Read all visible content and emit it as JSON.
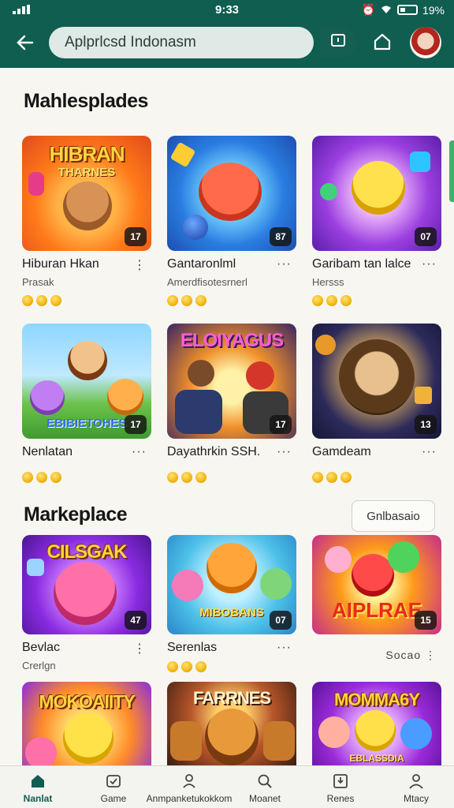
{
  "status_bar": {
    "time": "9:33",
    "battery": "19%"
  },
  "header": {
    "search_text": "Aplprlcsd Indonasm",
    "icons": [
      "back-icon",
      "chat-icon",
      "home-icon",
      "avatar"
    ]
  },
  "section1": {
    "title": "Mahlesplades",
    "cards": [
      {
        "art_title": "HIBRAN",
        "art_sub": "THARNES",
        "badge": "17",
        "name": "Hiburan Hkan",
        "sub": "Prasak",
        "more": "⋮",
        "rating": 3
      },
      {
        "art_title": "",
        "art_sub": "",
        "badge": "87",
        "name": "Gantaronlml",
        "sub": "Amerdfisotesrnerl",
        "more": "···",
        "rating": 3
      },
      {
        "art_title": "",
        "art_sub": "",
        "badge": "07",
        "name": "Garibam tan lalce",
        "sub": "Hersss",
        "more": "···",
        "rating": 3
      },
      {
        "art_title": "",
        "art_sub": "EBIBIETOHES",
        "badge": "17",
        "name": "Nenlatan",
        "sub": "",
        "more": "···",
        "rating": 3
      },
      {
        "art_title": "ELOIYAGUS",
        "art_sub": "",
        "badge": "17",
        "name": "Dayathrkin SSH.",
        "sub": "",
        "more": "···",
        "rating": 3
      },
      {
        "art_title": "",
        "art_sub": "",
        "badge": "13",
        "name": "Gamdeam",
        "sub": "",
        "more": "···",
        "rating": 3
      }
    ]
  },
  "section2": {
    "title": "Markeplace",
    "button_label": "Gnlbasaio",
    "cards": [
      {
        "art_title": "CILSGAK",
        "art_sub": "",
        "badge": "47",
        "name": "Bevlac",
        "sub": "Crerlgn",
        "more": "⋮",
        "rating": 0
      },
      {
        "art_title": "",
        "art_sub": "MIBOBANS",
        "badge": "07",
        "name": "Serenlas",
        "sub": "",
        "more": "···",
        "rating": 3
      },
      {
        "art_title": "",
        "art_sub": "AIPLRAE",
        "badge": "15",
        "name": "",
        "sub": "",
        "more": "Socao ⋮",
        "rating": 0
      },
      {
        "art_title": "MOKOAIITY",
        "art_sub": "",
        "badge": "",
        "name": "",
        "sub": "",
        "more": "",
        "rating": 0
      },
      {
        "art_title": "FARRNES",
        "art_sub": "",
        "badge": "",
        "name": "",
        "sub": "",
        "more": "",
        "rating": 0
      },
      {
        "art_title": "MOMMA6Y",
        "art_sub": "EBLASSDIA",
        "badge": "",
        "name": "",
        "sub": "",
        "more": "",
        "rating": 0
      }
    ]
  },
  "bottom_nav": [
    {
      "label": "Nanlat",
      "icon": "home-icon",
      "active": true
    },
    {
      "label": "Game",
      "icon": "game-icon",
      "active": false
    },
    {
      "label": "Anmpanketukokkom",
      "icon": "people-icon",
      "active": false
    },
    {
      "label": "Moanet",
      "icon": "search-icon",
      "active": false
    },
    {
      "label": "Renes",
      "icon": "download-icon",
      "active": false
    },
    {
      "label": "Mtacy",
      "icon": "user-icon",
      "active": false
    }
  ],
  "colors": {
    "header": "#0f5e50",
    "accent_green": "#3fb16b",
    "coin": "#f1b710"
  }
}
